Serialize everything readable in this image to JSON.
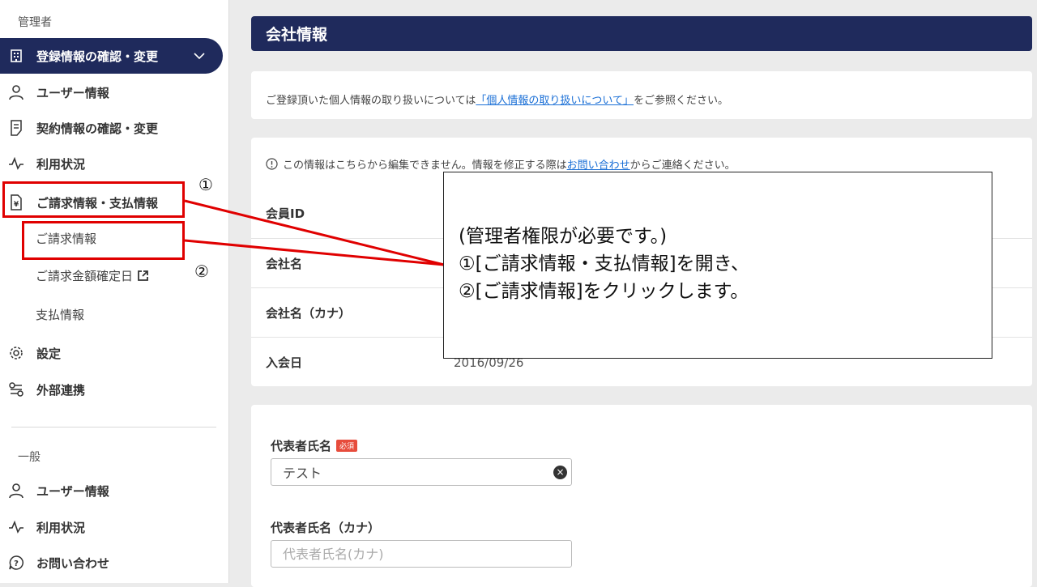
{
  "sidebar": {
    "section_admin": "管理者",
    "section_general": "一般",
    "admin_items": [
      {
        "label": "登録情報の確認・変更",
        "icon": "building-icon"
      },
      {
        "label": "ユーザー情報",
        "icon": "user-icon"
      },
      {
        "label": "契約情報の確認・変更",
        "icon": "document-icon"
      },
      {
        "label": "利用状況",
        "icon": "activity-icon"
      },
      {
        "label": "ご請求情報・支払情報",
        "icon": "invoice-icon"
      }
    ],
    "billing_subitems": [
      {
        "label": "ご請求情報"
      },
      {
        "label": "ご請求金額確定日",
        "icon": "external-link-icon"
      },
      {
        "label": "支払情報"
      }
    ],
    "admin_items_after": [
      {
        "label": "設定",
        "icon": "gear-icon"
      },
      {
        "label": "外部連携",
        "icon": "integration-icon"
      }
    ],
    "general_items": [
      {
        "label": "ユーザー情報",
        "icon": "user-icon"
      },
      {
        "label": "利用状況",
        "icon": "activity-icon"
      },
      {
        "label": "お問い合わせ",
        "icon": "help-icon"
      }
    ]
  },
  "main": {
    "title": "会社情報",
    "privacy_notice": {
      "before": "ご登録頂いた個人情報の取り扱いについては",
      "link": "「個人情報の取り扱いについて」",
      "after": "をご参照ください。"
    },
    "info_note": {
      "before": "この情報はこちらから編集できません。情報を修正する際は",
      "link": "お問い合わせ",
      "after": "からご連絡ください。"
    },
    "rows": [
      {
        "label": "会員ID",
        "value": ""
      },
      {
        "label": "会社名",
        "value": ""
      },
      {
        "label": "会社名（カナ）",
        "value": ""
      },
      {
        "label": "入会日",
        "value": "2016/09/26"
      }
    ],
    "representative_name": {
      "label": "代表者氏名",
      "required": "必須",
      "value": "テスト"
    },
    "representative_kana": {
      "label": "代表者氏名（カナ）",
      "placeholder": "代表者氏名(カナ)"
    }
  },
  "annotation": {
    "num1": "①",
    "num2": "②",
    "line1": "(管理者権限が必要です。)",
    "line2": "①[ご請求情報・支払情報]を開き、",
    "line3": "②[ご請求情報]をクリックします。"
  },
  "colors": {
    "navy": "#1f2a5c",
    "annotation_red": "#e00000",
    "required_red": "#e74c3c"
  }
}
